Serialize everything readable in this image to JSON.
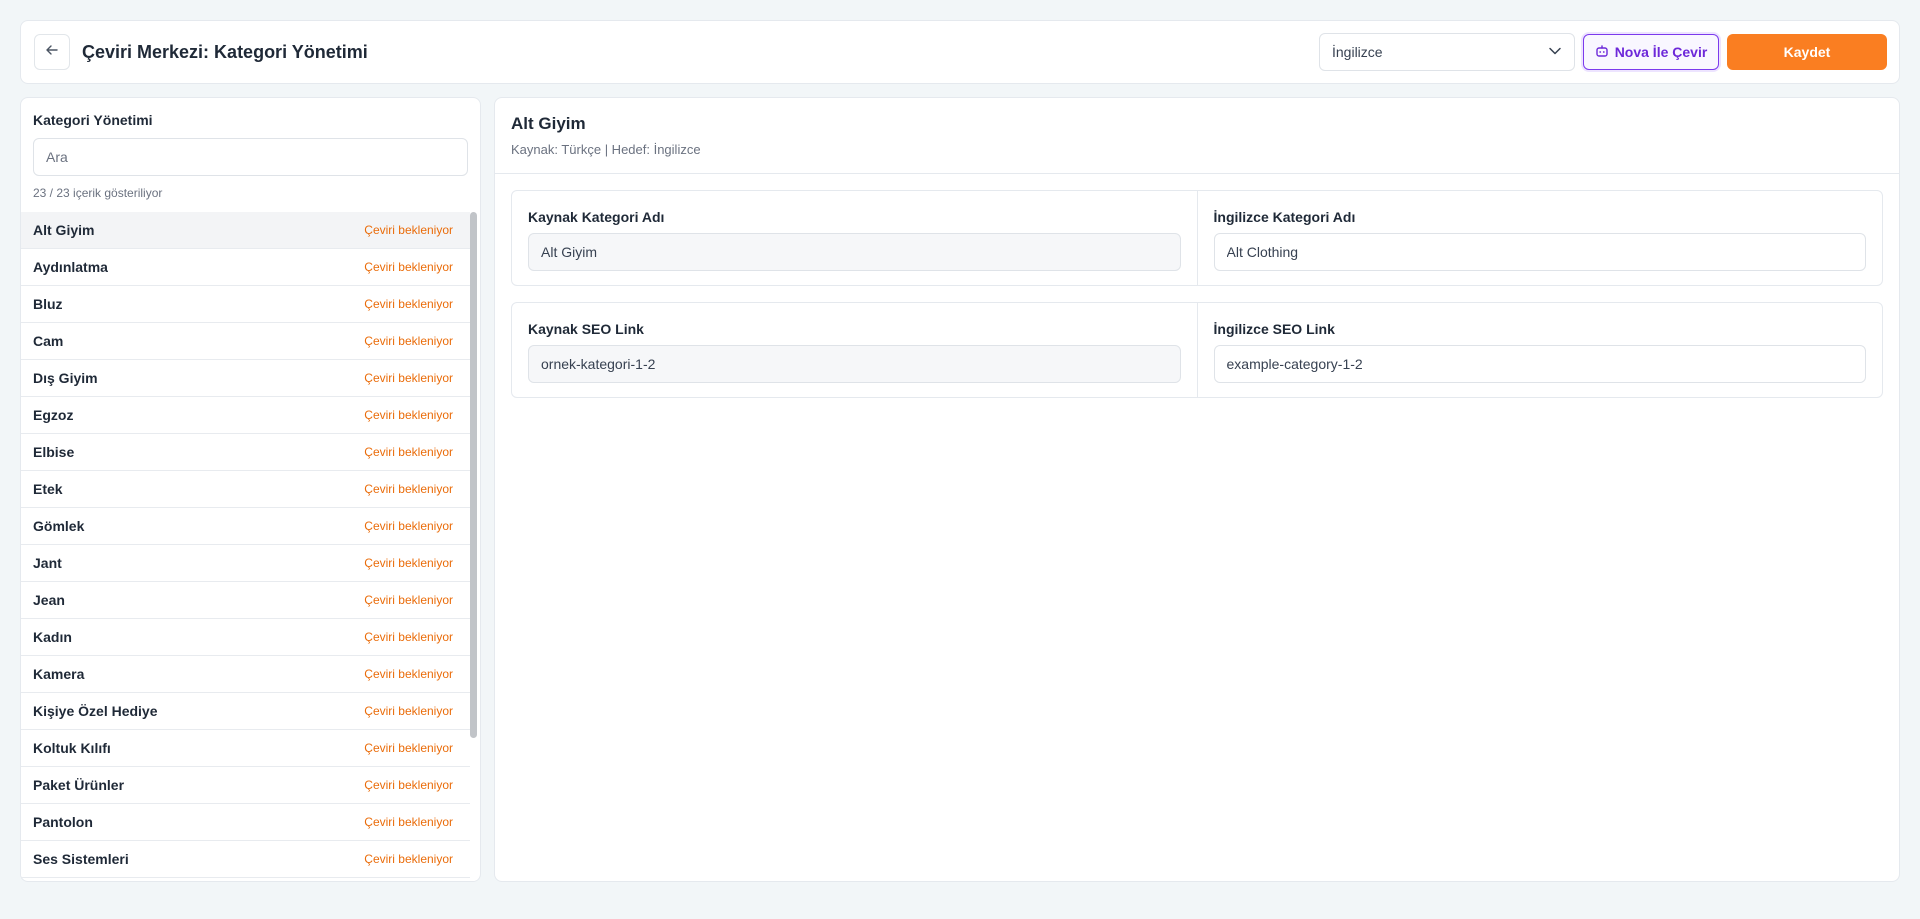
{
  "header": {
    "title": "Çeviri Merkezi: Kategori Yönetimi",
    "language_select": "İngilizce",
    "nova_label": "Nova İle Çevir",
    "save_label": "Kaydet"
  },
  "sidebar": {
    "title": "Kategori Yönetimi",
    "search_placeholder": "Ara",
    "count_text": "23 / 23 içerik gösteriliyor",
    "items": [
      {
        "name": "Alt Giyim",
        "status": "Çeviri bekleniyor"
      },
      {
        "name": "Aydınlatma",
        "status": "Çeviri bekleniyor"
      },
      {
        "name": "Bluz",
        "status": "Çeviri bekleniyor"
      },
      {
        "name": "Cam",
        "status": "Çeviri bekleniyor"
      },
      {
        "name": "Dış Giyim",
        "status": "Çeviri bekleniyor"
      },
      {
        "name": "Egzoz",
        "status": "Çeviri bekleniyor"
      },
      {
        "name": "Elbise",
        "status": "Çeviri bekleniyor"
      },
      {
        "name": "Etek",
        "status": "Çeviri bekleniyor"
      },
      {
        "name": "Gömlek",
        "status": "Çeviri bekleniyor"
      },
      {
        "name": "Jant",
        "status": "Çeviri bekleniyor"
      },
      {
        "name": "Jean",
        "status": "Çeviri bekleniyor"
      },
      {
        "name": "Kadın",
        "status": "Çeviri bekleniyor"
      },
      {
        "name": "Kamera",
        "status": "Çeviri bekleniyor"
      },
      {
        "name": "Kişiye Özel Hediye",
        "status": "Çeviri bekleniyor"
      },
      {
        "name": "Koltuk Kılıfı",
        "status": "Çeviri bekleniyor"
      },
      {
        "name": "Paket Ürünler",
        "status": "Çeviri bekleniyor"
      },
      {
        "name": "Pantolon",
        "status": "Çeviri bekleniyor"
      },
      {
        "name": "Ses Sistemleri",
        "status": "Çeviri bekleniyor"
      }
    ]
  },
  "main": {
    "title": "Alt Giyim",
    "subtitle": "Kaynak: Türkçe | Hedef: İngilizce",
    "name_card": {
      "source_label": "Kaynak Kategori Adı",
      "source_value": "Alt Giyim",
      "target_label": "İngilizce Kategori Adı",
      "target_value": "Alt Clothing"
    },
    "seo_card": {
      "source_label": "Kaynak SEO Link",
      "source_value": "ornek-kategori-1-2",
      "target_label": "İngilizce SEO Link",
      "target_value": "example-category-1-2"
    }
  },
  "colors": {
    "accent_orange": "#fa7e21",
    "nova_purple": "#6d28d9",
    "status_orange": "#ea6c0a"
  },
  "icons": {
    "back": "arrow-left-icon",
    "dropdown": "chevron-down-icon",
    "nova": "robot-icon"
  }
}
